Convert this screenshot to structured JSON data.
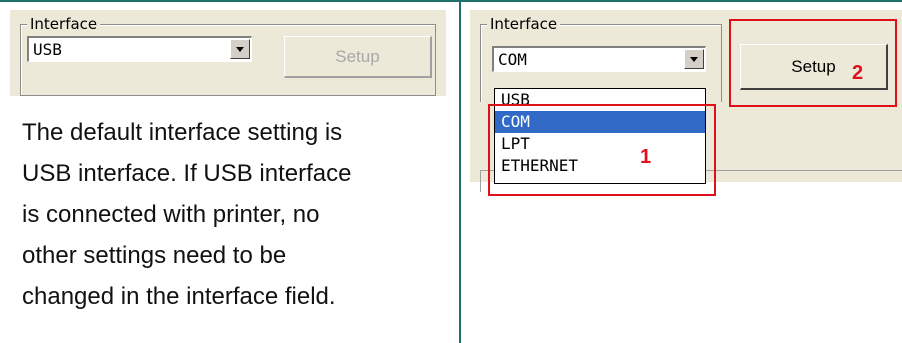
{
  "left_panel": {
    "interface_label": "Interface",
    "combo_value": "USB",
    "setup_button": "Setup",
    "description_lines": [
      "The default interface setting is",
      "USB interface. If USB interface",
      "is connected with printer, no",
      "other settings need to be",
      "changed in the interface field."
    ]
  },
  "right_panel": {
    "interface_label": "Interface",
    "combo_value": "COM",
    "setup_button": "Setup",
    "dropdown_options": [
      "USB",
      "COM",
      "LPT",
      "ETHERNET"
    ],
    "selected_option": "COM",
    "callout_1": "1",
    "callout_2": "2"
  },
  "colors": {
    "highlight_red": "#e0101a",
    "selection_blue": "#3169c6",
    "table_border": "#1f6f6b"
  }
}
